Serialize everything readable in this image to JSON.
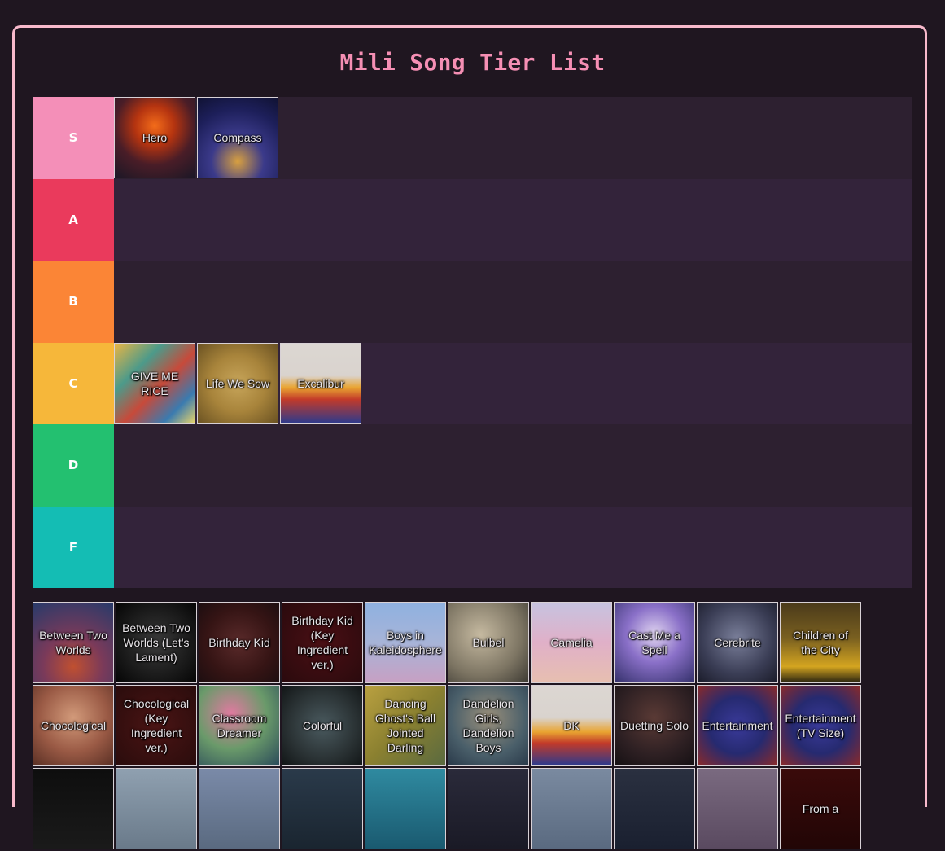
{
  "title": "Mili Song Tier List",
  "tiers": [
    {
      "label": "S",
      "color": "#f48fb8",
      "items": [
        {
          "name": "Hero",
          "bg": "radial-gradient(circle at 50% 35%, #f36c1a 0%, #b53410 30%, #4a1d27 60%, #1b1726 100%)"
        },
        {
          "name": "Compass",
          "bg": "radial-gradient(circle at 50% 80%, #d8a040 0%, #3b3a8a 35%, #1d1f5a 70%, #101233 100%)"
        }
      ]
    },
    {
      "label": "A",
      "color": "#ea3a5c",
      "items": []
    },
    {
      "label": "B",
      "color": "#fb8536",
      "items": []
    },
    {
      "label": "C",
      "color": "#f6b73a",
      "items": [
        {
          "name": "GIVE ME RICE",
          "bg": "linear-gradient(135deg, #e8b545 0%, #4c9a8a 30%, #c74a3a 55%, #3a7bb0 80%, #e8d46a 100%)"
        },
        {
          "name": "Life We Sow",
          "bg": "radial-gradient(circle at 50% 50%, #c7a55a 0%, #a8843b 50%, #6a5222 100%)"
        },
        {
          "name": "Excalibur",
          "bg": "linear-gradient(180deg, #dcd7d2 0%, #d9d3ce 40%, #e9a431 55%, #c23a2a 70%, #2b3a8e 100%)"
        }
      ]
    },
    {
      "label": "D",
      "color": "#23c070",
      "items": []
    },
    {
      "label": "F",
      "color": "#14bdb4",
      "items": []
    }
  ],
  "pool": [
    {
      "name": "Between Two Worlds",
      "bg": "radial-gradient(circle at 50% 80%, #c05030 0%, #7a3a5a 40%, #273a6a 100%)"
    },
    {
      "name": "Between Two Worlds (Let's Lament)",
      "bg": "radial-gradient(circle at 50% 50%, #3a3a3a 0%, #151515 70%, #050505 100%)"
    },
    {
      "name": "Birthday Kid",
      "bg": "radial-gradient(circle at 50% 50%, #5a2a2a 0%, #351414 60%, #1d0e10 100%)"
    },
    {
      "name": "Birthday Kid (Key Ingredient ver.)",
      "bg": "radial-gradient(circle at 50% 50%, #4a0f14 0%, #2a0a0d 100%)"
    },
    {
      "name": "Boys in Kaleidosphere",
      "bg": "linear-gradient(180deg, #8fb1e0 0%, #a7b4d8 50%, #c7a0c3 100%)"
    },
    {
      "name": "Bulbel",
      "bg": "radial-gradient(circle at 40% 40%, #c5b9a0 0%, #7d7563 60%, #3d3a33 100%)"
    },
    {
      "name": "Camelia",
      "bg": "linear-gradient(180deg, #c7c3e0 0%, #e0b0c8 50%, #e7bfb0 100%)"
    },
    {
      "name": "Cast Me a Spell",
      "bg": "radial-gradient(circle at 50% 40%, #e0d4f0 0%, #8a70c8 45%, #33306a 100%)"
    },
    {
      "name": "Cerebrite",
      "bg": "radial-gradient(circle at 50% 45%, #7a7f9a 0%, #3a3d55 60%, #1a1b29 100%)"
    },
    {
      "name": "Children of the City",
      "bg": "linear-gradient(180deg, #4a3a1a 0%, #7a6020 45%, #d4a520 80%, #2a2410 100%)"
    },
    {
      "name": "Chocological",
      "bg": "radial-gradient(circle at 50% 40%, #d29a7a 0%, #9a5a45 55%, #5a3025 100%)"
    },
    {
      "name": "Chocological (Key Ingredient ver.)",
      "bg": "radial-gradient(circle at 50% 50%, #4a1414 0%, #2a0c0c 100%)"
    },
    {
      "name": "Classroom Dreamer",
      "bg": "radial-gradient(circle at 40% 35%, #e07aa0 0%, #6a9a6a 50%, #2a4a5a 100%)"
    },
    {
      "name": "Colorful",
      "bg": "radial-gradient(circle at 50% 50%, #4a5a5f 0%, #2a3234 60%, #121617 100%)"
    },
    {
      "name": "Dancing Ghost's Ball Jointed Darling",
      "bg": "linear-gradient(135deg, #b9a040 0%, #8a8030 50%, #5a6a40 100%)"
    },
    {
      "name": "Dandelion Girls, Dandelion Boys",
      "bg": "radial-gradient(circle at 50% 40%, #9a8f7a 0%, #4a5f6a 60%, #2a3a4a 100%)"
    },
    {
      "name": "DK",
      "bg": "linear-gradient(180deg, #dcd7d2 0%, #d9d3ce 40%, #e9a431 58%, #c23a2a 72%, #2b3a8e 100%)"
    },
    {
      "name": "Duetting Solo",
      "bg": "radial-gradient(circle at 50% 40%, #5a3a35 0%, #2e2023 60%, #151013 100%)"
    },
    {
      "name": "Entertainment",
      "bg": "radial-gradient(circle at 50% 50%, #3a3a9a 0%, #262a70 50%, #8a2a2a 100%)"
    },
    {
      "name": "Entertainment (TV Size)",
      "bg": "radial-gradient(circle at 50% 50%, #3a3a9a 0%, #262a70 50%, #8a2a2a 100%)"
    },
    {
      "name": "",
      "bg": "linear-gradient(180deg, #0e0e0e 0%, #1a1a1a 100%)"
    },
    {
      "name": "",
      "bg": "linear-gradient(180deg, #8fa0b0 0%, #6a7a8a 100%)"
    },
    {
      "name": "",
      "bg": "linear-gradient(180deg, #7a8aa8 0%, #5a6a80 100%)"
    },
    {
      "name": "",
      "bg": "linear-gradient(180deg, #2a3a4a 0%, #1a2530 100%)"
    },
    {
      "name": "",
      "bg": "linear-gradient(180deg, #2f8aa0 0%, #1a5a70 100%)"
    },
    {
      "name": "",
      "bg": "linear-gradient(180deg, #2a2a3a 0%, #1a1a26 100%)"
    },
    {
      "name": "",
      "bg": "linear-gradient(180deg, #7a8aa0 0%, #5a6a80 100%)"
    },
    {
      "name": "",
      "bg": "linear-gradient(180deg, #2a3040 0%, #1a2030 100%)"
    },
    {
      "name": "",
      "bg": "linear-gradient(180deg, #7a6a80 0%, #5a4a60 100%)"
    },
    {
      "name": "From a",
      "bg": "linear-gradient(180deg, #3a0a0a 0%, #220606 100%)"
    }
  ]
}
